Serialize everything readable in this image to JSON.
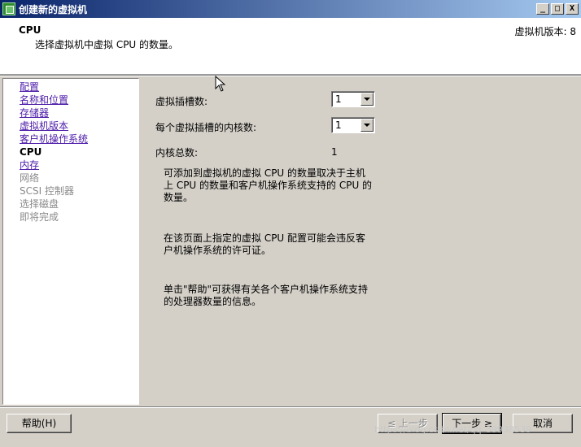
{
  "window": {
    "title": "创建新的虚拟机",
    "controls": {
      "minimize": "_",
      "maximize": "□",
      "close": "X"
    }
  },
  "header": {
    "title": "CPU",
    "description": "选择虚拟机中虚拟 CPU 的数量。",
    "version": "虚拟机版本: 8"
  },
  "nav": {
    "items": [
      {
        "label": "配置",
        "state": "link"
      },
      {
        "label": "名称和位置",
        "state": "link"
      },
      {
        "label": "存储器",
        "state": "link"
      },
      {
        "label": "虚拟机版本",
        "state": "link"
      },
      {
        "label": "客户机操作系统",
        "state": "link"
      },
      {
        "label": "CPU",
        "state": "current"
      },
      {
        "label": "内存",
        "state": "link"
      },
      {
        "label": "网络",
        "state": "disabled"
      },
      {
        "label": "SCSI 控制器",
        "state": "disabled"
      },
      {
        "label": "选择磁盘",
        "state": "disabled"
      },
      {
        "label": "即将完成",
        "state": "disabled"
      }
    ]
  },
  "form": {
    "sockets_label": "虚拟插槽数:",
    "sockets_value": "1",
    "cores_label": "每个虚拟插槽的内核数:",
    "cores_value": "1",
    "total_label": "内核总数:",
    "total_value": "1"
  },
  "info": {
    "p1": "可添加到虚拟机的虚拟 CPU 的数量取决于主机上 CPU 的数量和客户机操作系统支持的 CPU 的数量。",
    "p2": "在该页面上指定的虚拟 CPU 配置可能会违反客户机操作系统的许可证。",
    "p3": "单击\"帮助\"可获得有关各个客户机操作系统支持的处理器数量的信息。"
  },
  "buttons": {
    "help": "帮助(H)",
    "back": "≤ 上一步",
    "next": "下一步 ≥",
    "cancel": "取消"
  },
  "watermark": "https://blog.csdn.net/qq_39938539",
  "colors": {
    "title_start": "#0a246a",
    "title_end": "#a6caf0",
    "link": "#4b1aa8",
    "face": "#d4d0c8"
  }
}
